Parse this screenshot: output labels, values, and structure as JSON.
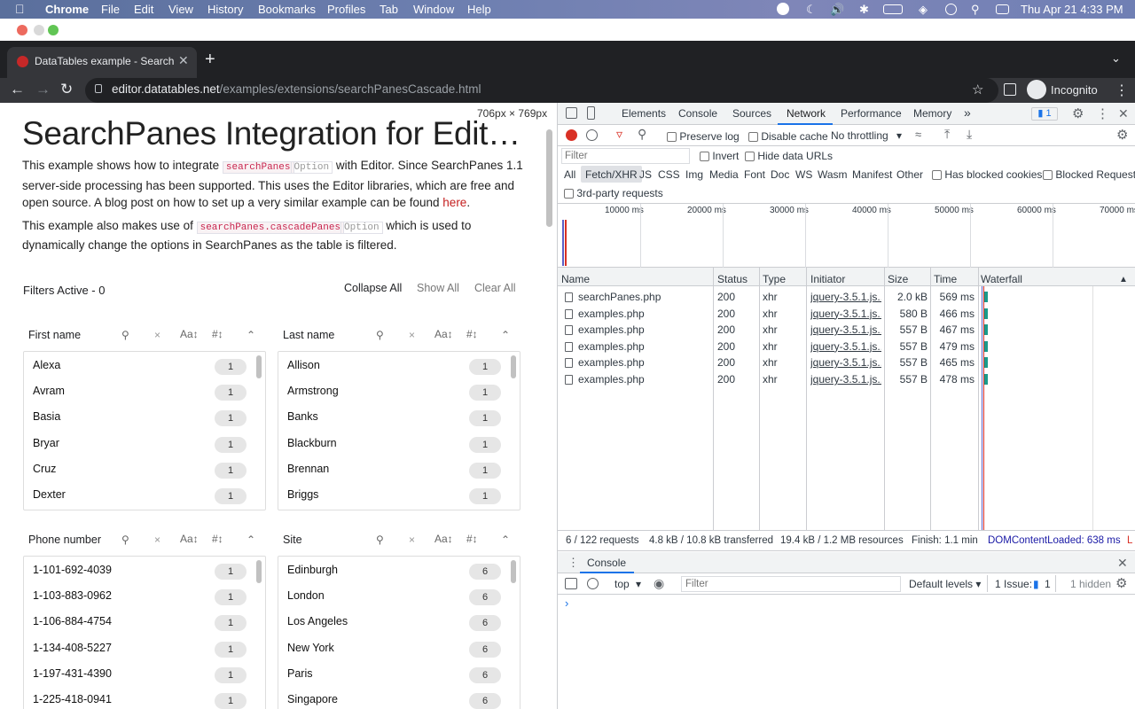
{
  "menubar": {
    "app": "Chrome",
    "items": [
      "File",
      "Edit",
      "View",
      "History",
      "Bookmarks",
      "Profiles",
      "Tab",
      "Window",
      "Help"
    ],
    "clock": "Thu Apr 21  4:33 PM"
  },
  "browser": {
    "tab_title": "DataTables example - SearchPa",
    "url_host": "editor.datatables.net",
    "url_path": "/examples/extensions/searchPanesCascade.html",
    "profile": "Incognito",
    "dims": "706px × 769px"
  },
  "page": {
    "title": "SearchPanes Integration for Edit…",
    "p1_a": "This example shows how to integrate ",
    "p1_code": "searchPanes",
    "p1_opt": "Option",
    "p1_b": " with Editor. Since SearchPanes 1.1 server-side processing has been supported. This uses the Editor libraries, which are free and open source. A blog post on how to set up a very similar example can be found ",
    "p1_link": "here",
    "p1_end": ".",
    "p2_a": "This example also makes use of ",
    "p2_code": "searchPanes.cascadePanes",
    "p2_opt": "Option",
    "p2_b": " which is used to dynamically change the options in SearchPanes as the table is filtered.",
    "filters_active": "Filters Active - 0",
    "collapse_all": "Collapse All",
    "show_all": "Show All",
    "clear_all": "Clear All",
    "panes": [
      {
        "title": "First name",
        "rows": [
          {
            "v": "Alexa",
            "c": "1"
          },
          {
            "v": "Avram",
            "c": "1"
          },
          {
            "v": "Basia",
            "c": "1"
          },
          {
            "v": "Bryar",
            "c": "1"
          },
          {
            "v": "Cruz",
            "c": "1"
          },
          {
            "v": "Dexter",
            "c": "1"
          }
        ]
      },
      {
        "title": "Last name",
        "rows": [
          {
            "v": "Allison",
            "c": "1"
          },
          {
            "v": "Armstrong",
            "c": "1"
          },
          {
            "v": "Banks",
            "c": "1"
          },
          {
            "v": "Blackburn",
            "c": "1"
          },
          {
            "v": "Brennan",
            "c": "1"
          },
          {
            "v": "Briggs",
            "c": "1"
          }
        ]
      },
      {
        "title": "Phone number",
        "rows": [
          {
            "v": "1-101-692-4039",
            "c": "1"
          },
          {
            "v": "1-103-883-0962",
            "c": "1"
          },
          {
            "v": "1-106-884-4754",
            "c": "1"
          },
          {
            "v": "1-134-408-5227",
            "c": "1"
          },
          {
            "v": "1-197-431-4390",
            "c": "1"
          },
          {
            "v": "1-225-418-0941",
            "c": "1"
          }
        ]
      },
      {
        "title": "Site",
        "rows": [
          {
            "v": "Edinburgh",
            "c": "6"
          },
          {
            "v": "London",
            "c": "6"
          },
          {
            "v": "Los Angeles",
            "c": "6"
          },
          {
            "v": "New York",
            "c": "6"
          },
          {
            "v": "Paris",
            "c": "6"
          },
          {
            "v": "Singapore",
            "c": "6"
          }
        ]
      }
    ]
  },
  "devtools": {
    "tabs": [
      "Elements",
      "Console",
      "Sources",
      "Network",
      "Performance",
      "Memory"
    ],
    "issues_badge": "1",
    "preserve_log": "Preserve log",
    "disable_cache": "Disable cache",
    "throttling": "No throttling",
    "filter_placeholder": "Filter",
    "invert": "Invert",
    "hide_data_urls": "Hide data URLs",
    "types": [
      "All",
      "Fetch/XHR",
      "JS",
      "CSS",
      "Img",
      "Media",
      "Font",
      "Doc",
      "WS",
      "Wasm",
      "Manifest",
      "Other"
    ],
    "has_blocked_cookies": "Has blocked cookies",
    "blocked_requests": "Blocked Requests",
    "third_party": "3rd-party requests",
    "timeline_ticks": [
      "10000 ms",
      "20000 ms",
      "30000 ms",
      "40000 ms",
      "50000 ms",
      "60000 ms",
      "70000 ms"
    ],
    "columns": [
      "Name",
      "Status",
      "Type",
      "Initiator",
      "Size",
      "Time",
      "Waterfall"
    ],
    "requests": [
      {
        "name": "searchPanes.php",
        "status": "200",
        "type": "xhr",
        "initiator": "jquery-3.5.1.js...",
        "size": "2.0 kB",
        "time": "569 ms"
      },
      {
        "name": "examples.php",
        "status": "200",
        "type": "xhr",
        "initiator": "jquery-3.5.1.js...",
        "size": "580 B",
        "time": "466 ms"
      },
      {
        "name": "examples.php",
        "status": "200",
        "type": "xhr",
        "initiator": "jquery-3.5.1.js...",
        "size": "557 B",
        "time": "467 ms"
      },
      {
        "name": "examples.php",
        "status": "200",
        "type": "xhr",
        "initiator": "jquery-3.5.1.js...",
        "size": "557 B",
        "time": "479 ms"
      },
      {
        "name": "examples.php",
        "status": "200",
        "type": "xhr",
        "initiator": "jquery-3.5.1.js...",
        "size": "557 B",
        "time": "465 ms"
      },
      {
        "name": "examples.php",
        "status": "200",
        "type": "xhr",
        "initiator": "jquery-3.5.1.js...",
        "size": "557 B",
        "time": "478 ms"
      }
    ],
    "summary": {
      "requests": "6 / 122 requests",
      "transferred": "4.8 kB / 10.8 kB transferred",
      "resources": "19.4 kB / 1.2 MB resources",
      "finish": "Finish: 1.1 min",
      "dcl": "DOMContentLoaded: 638 ms",
      "load": "L"
    },
    "console": {
      "title": "Console",
      "context": "top",
      "filter_placeholder": "Filter",
      "levels": "Default levels",
      "issues_label": "1 Issue:",
      "issues_count": "1",
      "hidden": "1 hidden",
      "prompt": "›"
    }
  },
  "colors": {
    "accent": "#1a73e8",
    "record": "#d93025",
    "link": "#c7254e",
    "dcl": "#1a1aa6"
  }
}
